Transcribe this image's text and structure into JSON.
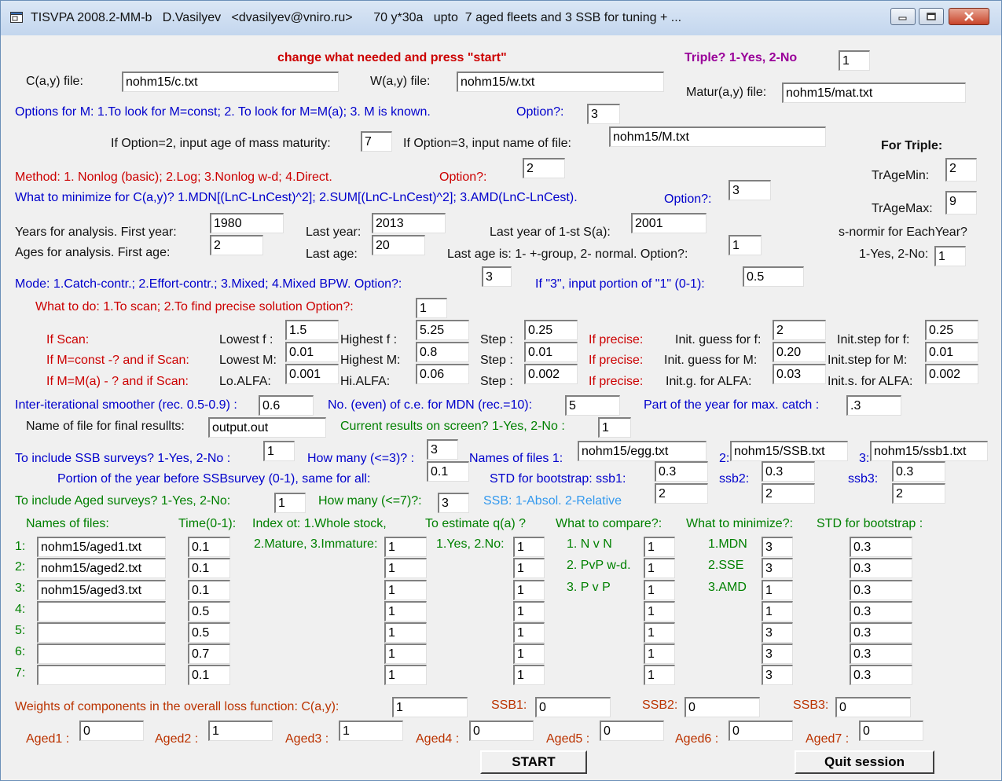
{
  "window": {
    "title": "TISVPA 2008.2-MM-b   D.Vasilyev   <dvasilyev@vniro.ru>      70 y*30a   upto  7 aged fleets and 3 SSB for tuning + ...",
    "minimize_icon": "minimize-icon",
    "maximize_icon": "maximize-icon",
    "close_icon": "close-icon"
  },
  "header": {
    "instruction": "change what needed and press \"start\"",
    "triple_label": "Triple? 1-Yes, 2-No",
    "triple_value": "1"
  },
  "files": {
    "c_label": "C(a,y) file:",
    "c_value": "nohm15/c.txt",
    "w_label": "W(a,y) file:",
    "w_value": "nohm15/w.txt",
    "matur_label": "Matur(a,y) file:",
    "matur_value": "nohm15/mat.txt"
  },
  "m_options": {
    "label": "Options for M: 1.To look for M=const;  2. To look for M=M(a); 3. M is known.",
    "option_label": "Option?:",
    "option_value": "3",
    "maturity_label": "If Option=2, input age of mass maturity:",
    "maturity_value": "7",
    "file_label": "If Option=3, input name of file:",
    "file_value": "nohm15/M.txt"
  },
  "method": {
    "label": "Method: 1. Nonlog (basic);   2.Log;  3.Nonlog w-d;  4.Direct.",
    "option_label": "Option?:",
    "option_value": "2"
  },
  "minimize": {
    "label": "What to minimize for C(a,y)? 1.MDN[(LnC-LnCest)^2];  2.SUM[(LnC-LnCest)^2]; 3.AMD(LnC-LnCest).",
    "option_label": "Option?:",
    "option_value": "3"
  },
  "triple": {
    "title": "For Triple:",
    "tragemin_label": "TrAgeMin:",
    "tragemin_value": "2",
    "tragemax_label": "TrAgeMax:",
    "tragemax_value": "9",
    "snormir_label": "s-normir for EachYear?",
    "yesno_label": "1-Yes, 2-No:",
    "snormir_value": "1"
  },
  "years": {
    "first_label": "Years for analysis.  First year:",
    "first_value": "1980",
    "last_label": "Last year:",
    "last_value": "2013",
    "last_s_label": "Last year of 1-st S(a):",
    "last_s_value": "2001"
  },
  "ages": {
    "first_label": "Ages for analysis.  First age:",
    "first_value": "2",
    "last_label": "Last age:",
    "last_value": "20",
    "last_is_label": "Last age is: 1- +-group, 2- normal.  Option?:",
    "last_is_value": "1"
  },
  "mode": {
    "label": "Mode: 1.Catch-contr.; 2.Effort-contr.;  3.Mixed;  4.Mixed BPW.  Option?:",
    "value": "3",
    "portion_label": "If \"3\", input portion of \"1\" (0-1):",
    "portion_value": "0.5"
  },
  "todo": {
    "label": "What to do: 1.To scan; 2.To find precise solution  Option?:",
    "value": "1"
  },
  "scan": {
    "if_scan": "If Scan:",
    "if_mconst": "If M=const -? and if Scan:",
    "if_mma": "If M=M(a) - ? and if Scan:",
    "lowest_f_label": "Lowest f :",
    "lowest_f": "1.5",
    "lowest_m_label": "Lowest M:",
    "lowest_m": "0.01",
    "lo_alfa_label": "Lo.ALFA:",
    "lo_alfa": "0.001",
    "highest_f_label": "Highest f :",
    "highest_f": "5.25",
    "highest_m_label": "Highest M:",
    "highest_m": "0.8",
    "hi_alfa_label": "Hi.ALFA:",
    "hi_alfa": "0.06",
    "step_label": "Step :",
    "step_f": "0.25",
    "step_m": "0.01",
    "step_alfa": "0.002",
    "if_precise": "If precise:",
    "init_guess_f_label": "Init. guess for f:",
    "init_guess_f": "2",
    "init_guess_m_label": "Init. guess for M:",
    "init_guess_m": "0.20",
    "init_g_alfa_label": "Init.g. for ALFA:",
    "init_g_alfa": "0.03",
    "init_step_f_label": "Init.step for f:",
    "init_step_f": "0.25",
    "init_step_m_label": "Init.step for M:",
    "init_step_m": "0.01",
    "init_s_alfa_label": "Init.s. for ALFA:",
    "init_s_alfa": "0.002"
  },
  "smoother": {
    "label": "Inter-iterational smoother (rec. 0.5-0.9) :",
    "value": "0.6",
    "ce_label": "No. (even) of c.e. for MDN (rec.=10):",
    "ce_value": "5",
    "part_label": "Part of the year for max. catch :",
    "part_value": ".3"
  },
  "output": {
    "label": "Name of file for final resullts:",
    "value": "output.out",
    "screen_label": "Current results on screen? 1-Yes, 2-No :",
    "screen_value": "1"
  },
  "ssb": {
    "include_label": "To include SSB surveys? 1-Yes, 2-No :",
    "include_value": "1",
    "howmany_label": "How many (<=3)? :",
    "howmany_value": "3",
    "names_label": "Names of files 1:",
    "file1": "nohm15/egg.txt",
    "n2": "2:",
    "file2": "nohm15/SSB.txt",
    "n3": "3:",
    "file3": "nohm15/ssb1.txt",
    "portion_label": "Portion of the year before SSBsurvey (0-1), same for all:",
    "portion_value": "0.1",
    "std_label": "STD for bootstrap: ssb1:",
    "std1": "0.3",
    "ssb2_label": "ssb2:",
    "std2": "0.3",
    "ssb3_label": "ssb3:",
    "std3": "0.3",
    "absrel_label": "SSB: 1-Absol. 2-Relative",
    "rel1": "2",
    "rel2": "2",
    "rel3": "2"
  },
  "aged": {
    "include_label": "To include Aged surveys? 1-Yes, 2-No:",
    "include_value": "1",
    "howmany_label": "How many (<=7)?:",
    "howmany_value": "3",
    "names_header": "Names of files:",
    "time_header": "Time(0-1):",
    "index_header": "Index ot: 1.Whole stock,",
    "index_header2": "2.Mature, 3.Immature:",
    "q_header": "To estimate q(a) ?",
    "q_header2": "1.Yes, 2.No:",
    "compare_header": "What to compare?:",
    "compare_opt1": "1. N v N",
    "compare_opt2": "2. PvP w-d.",
    "compare_opt3": "3. P v P",
    "minimize_header": "What to minimize?:",
    "min_opt1": "1.MDN",
    "min_opt2": "2.SSE",
    "min_opt3": "3.AMD",
    "std_header": "STD for bootstrap :",
    "rows": [
      {
        "num": "1:",
        "file": "nohm15/aged1.txt",
        "time": "0.1",
        "index": "1",
        "q": "1",
        "compare": "1",
        "minimize": "3",
        "std": "0.3"
      },
      {
        "num": "2:",
        "file": "nohm15/aged2.txt",
        "time": "0.1",
        "index": "1",
        "q": "1",
        "compare": "1",
        "minimize": "3",
        "std": "0.3"
      },
      {
        "num": "3:",
        "file": "nohm15/aged3.txt",
        "time": "0.1",
        "index": "1",
        "q": "1",
        "compare": "1",
        "minimize": "1",
        "std": "0.3"
      },
      {
        "num": "4:",
        "file": "",
        "time": "0.5",
        "index": "1",
        "q": "1",
        "compare": "1",
        "minimize": "1",
        "std": "0.3"
      },
      {
        "num": "5:",
        "file": "",
        "time": "0.5",
        "index": "1",
        "q": "1",
        "compare": "1",
        "minimize": "3",
        "std": "0.3"
      },
      {
        "num": "6:",
        "file": "",
        "time": "0.7",
        "index": "1",
        "q": "1",
        "compare": "1",
        "minimize": "3",
        "std": "0.3"
      },
      {
        "num": "7:",
        "file": "",
        "time": "0.1",
        "index": "1",
        "q": "1",
        "compare": "1",
        "minimize": "3",
        "std": "0.3"
      }
    ]
  },
  "weights": {
    "label": "Weights of components in the overall loss function:  C(a,y):",
    "c_value": "1",
    "ssb1_label": "SSB1:",
    "ssb1_value": "0",
    "ssb2_label": "SSB2:",
    "ssb2_value": "0",
    "ssb3_label": "SSB3:",
    "ssb3_value": "0",
    "aged": [
      {
        "label": "Aged1 :",
        "value": "0"
      },
      {
        "label": "Aged2 :",
        "value": "1"
      },
      {
        "label": "Aged3 :",
        "value": "1"
      },
      {
        "label": "Aged4 :",
        "value": "0"
      },
      {
        "label": "Aged5 :",
        "value": "0"
      },
      {
        "label": "Aged6 :",
        "value": "0"
      },
      {
        "label": "Aged7 :",
        "value": "0"
      }
    ]
  },
  "buttons": {
    "start": "START",
    "quit": "Quit session"
  }
}
